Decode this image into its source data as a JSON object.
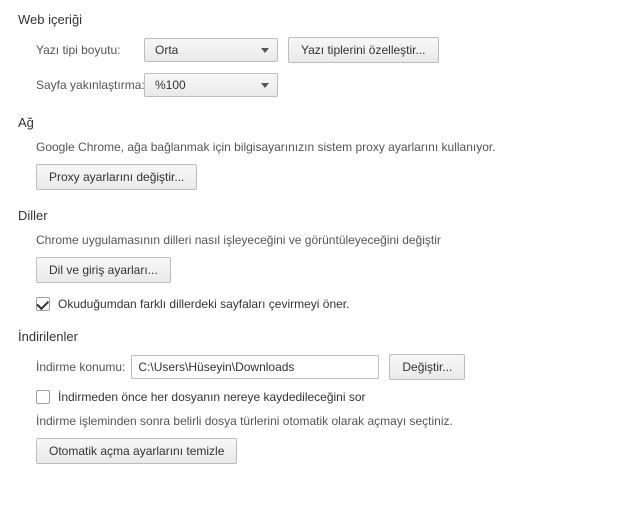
{
  "web_content": {
    "title": "Web içeriği",
    "font_size_label": "Yazı tipi boyutu:",
    "font_size_value": "Orta",
    "customize_fonts_button": "Yazı tiplerini özelleştir...",
    "page_zoom_label": "Sayfa yakınlaştırma:",
    "page_zoom_value": "%100"
  },
  "network": {
    "title": "Ağ",
    "description": "Google Chrome, ağa bağlanmak için bilgisayarınızın sistem proxy ayarlarını kullanıyor.",
    "proxy_button": "Proxy ayarlarını değiştir..."
  },
  "languages": {
    "title": "Diller",
    "description": "Chrome uygulamasının dilleri nasıl işleyeceğini ve görüntüleyeceğini değiştir",
    "lang_input_button": "Dil ve giriş ayarları...",
    "translate_checkbox_label": "Okuduğumdan farklı dillerdeki sayfaları çevirmeyi öner.",
    "translate_checked": true
  },
  "downloads": {
    "title": "İndirilenler",
    "location_label": "İndirme konumu:",
    "location_value": "C:\\Users\\Hüseyin\\Downloads",
    "change_button": "Değiştir...",
    "ask_checkbox_label": "İndirmeden önce her dosyanın nereye kaydedileceğini sor",
    "ask_checked": false,
    "auto_open_note": "İndirme işleminden sonra belirli dosya türlerini otomatik olarak açmayı seçtiniz.",
    "clear_auto_open_button": "Otomatik açma ayarlarını temizle"
  }
}
